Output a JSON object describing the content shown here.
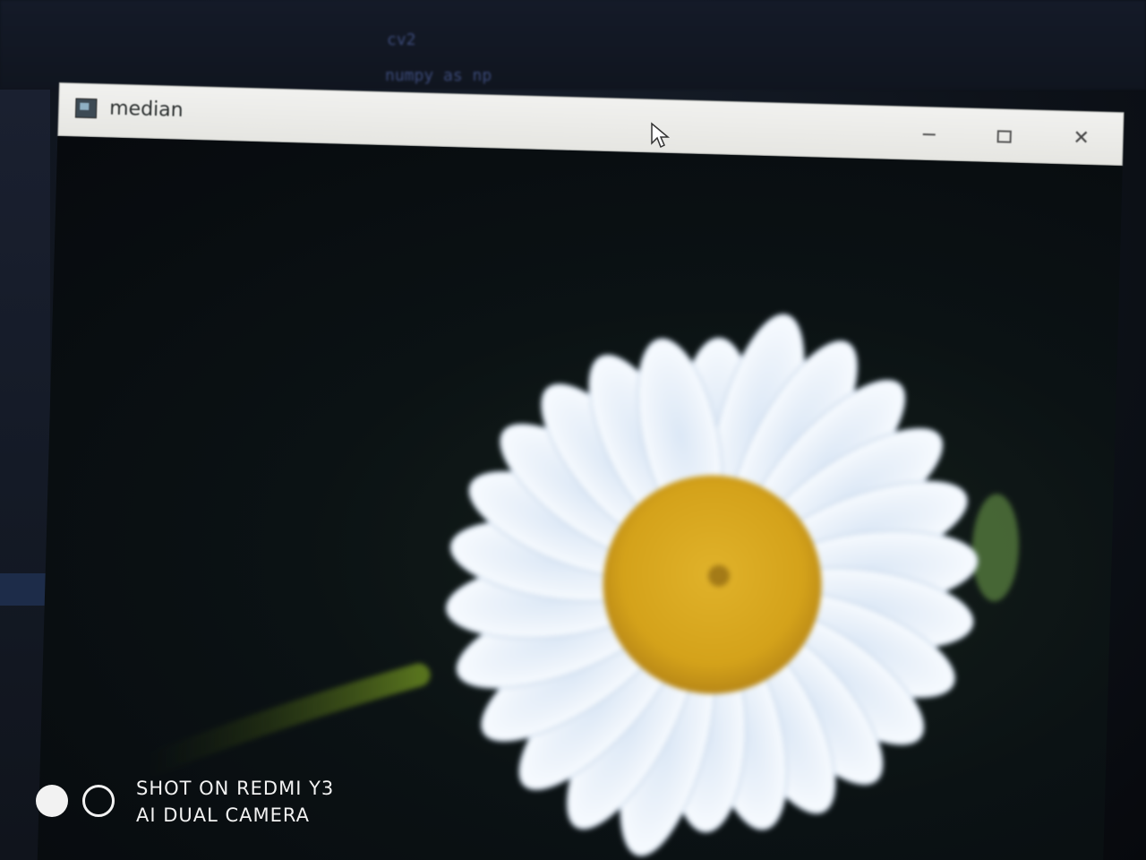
{
  "window": {
    "title": "median",
    "icon": "opencv-window-icon",
    "controls": {
      "minimize": "minimize-icon",
      "maximize": "maximize-icon",
      "close": "close-icon",
      "close_glyph": "✕"
    }
  },
  "background_code": {
    "lines": [
      "cv2",
      "numpy as np"
    ]
  },
  "image_content": {
    "subject": "white daisy",
    "colors": {
      "petals": "#eef4fb",
      "center": "#d4a21a",
      "center_dark": "#b07d10",
      "background": "#0b1214",
      "stem": "#5a7a1a"
    }
  },
  "watermark": {
    "line1": "SHOT ON REDMI Y3",
    "line2": "AI DUAL CAMERA"
  }
}
